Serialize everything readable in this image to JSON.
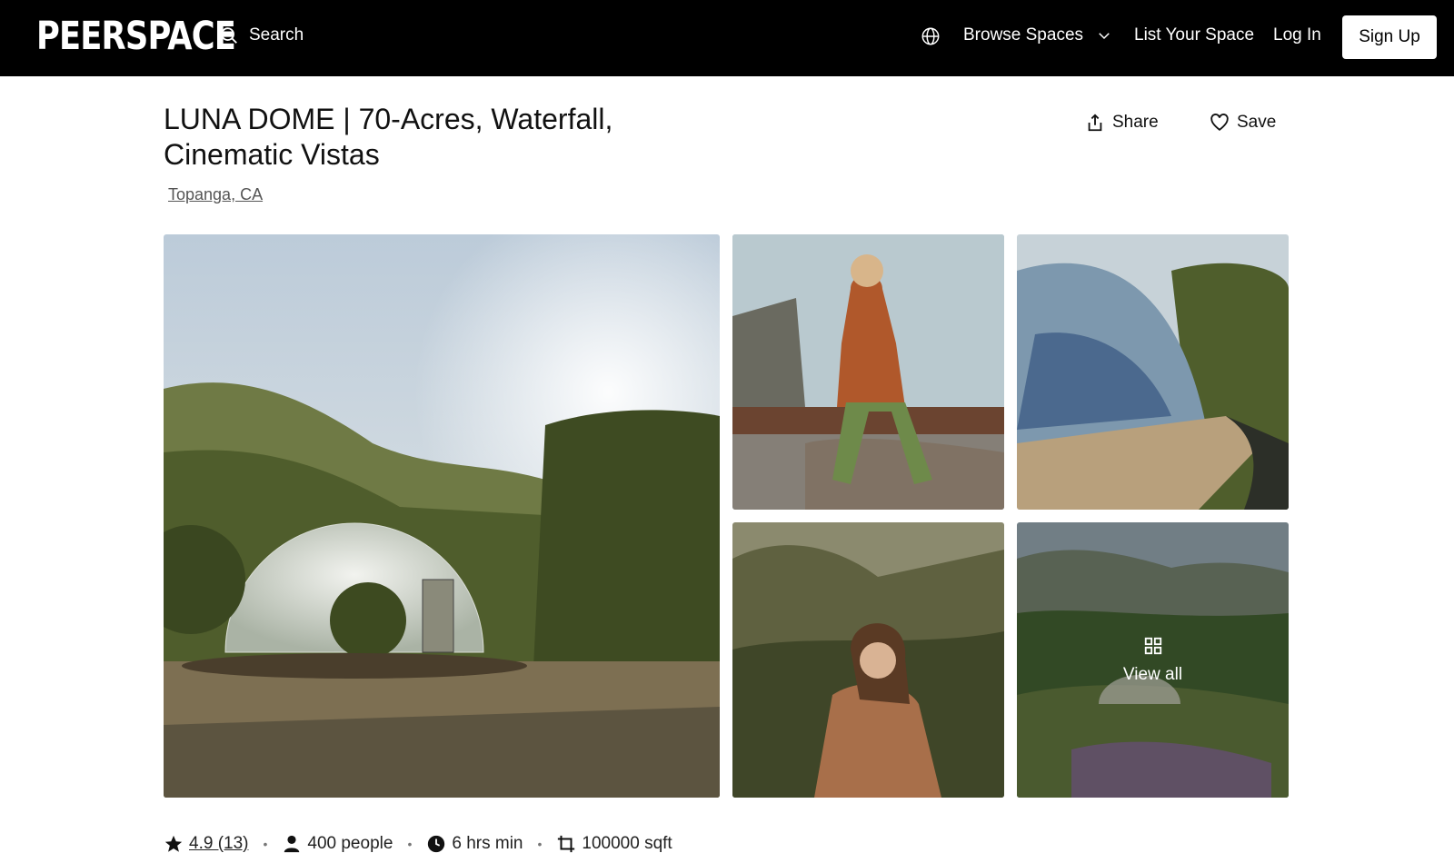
{
  "nav": {
    "logo": "PEERSPACE",
    "search_label": "Search",
    "browse_label": "Browse Spaces",
    "list_label": "List Your Space",
    "login_label": "Log In",
    "signup_label": "Sign Up"
  },
  "listing": {
    "title": "LUNA DOME | 70-Acres, Waterfall, Cinematic Vistas",
    "location": "Topanga, CA",
    "share_label": "Share",
    "save_label": "Save"
  },
  "gallery": {
    "view_all_label": "View all",
    "photos": [
      "geodesic-dome-hillside",
      "model-on-deck",
      "dome-deck-closeup",
      "woman-in-coat",
      "valley-landscape"
    ]
  },
  "stats": {
    "rating": "4.9 (13)",
    "capacity": "400 people",
    "hours": "6 hrs min",
    "area": "100000 sqft"
  },
  "colors": {
    "nav_bg": "#000000",
    "text": "#111111",
    "link": "#555555"
  }
}
